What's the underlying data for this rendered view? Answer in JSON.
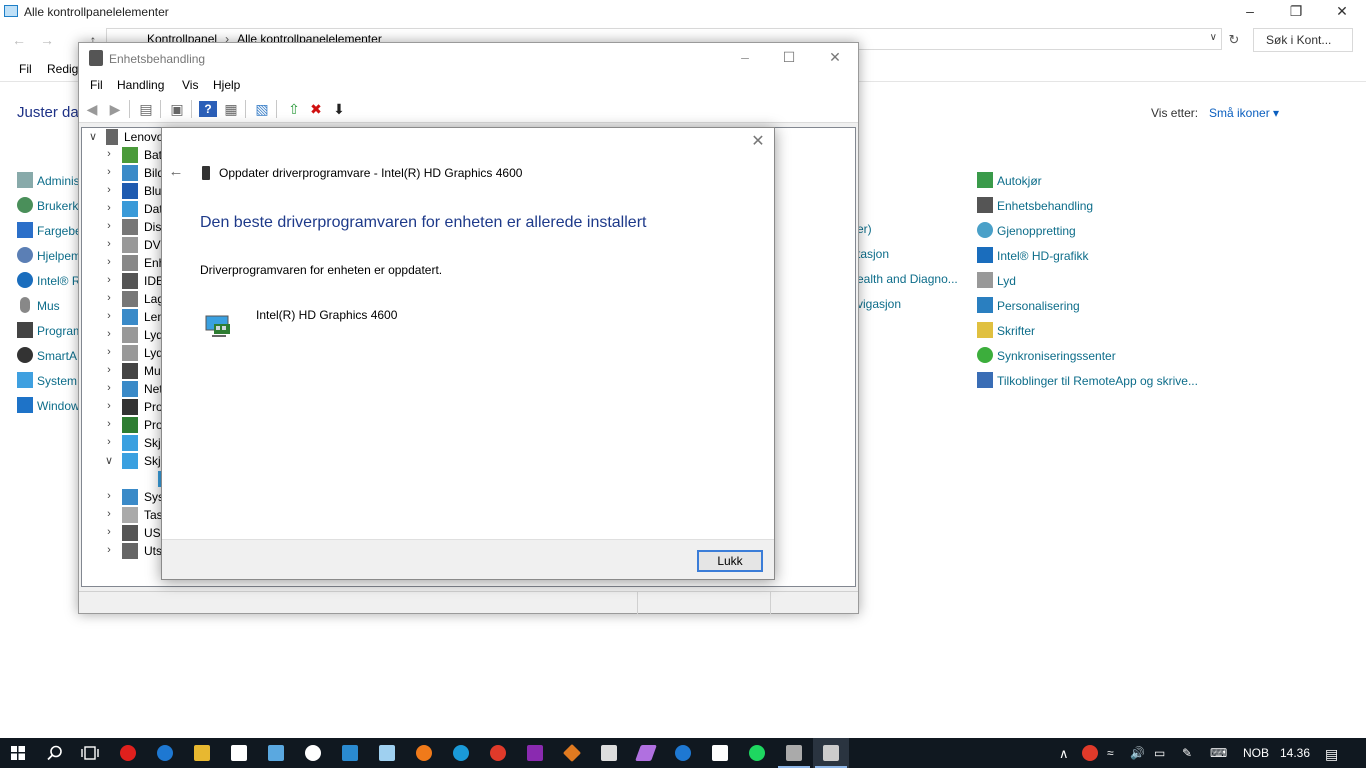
{
  "control_panel": {
    "title": "Alle kontrollpanelelementer",
    "breadcrumb": [
      "Kontrollpanel",
      "Alle kontrollpanelelementer"
    ],
    "search_placeholder": "Søk i Kont...",
    "menu": [
      "Fil",
      "Redige"
    ],
    "heading": "Juster da",
    "view_by_label": "Vis etter:",
    "view_by_value": "Små ikoner",
    "left_items": [
      "Adminis",
      "Brukerk",
      "Fargebe",
      "Hjelpem",
      "Intel® R",
      "Mus",
      "Program",
      "SmartA",
      "System",
      "Window"
    ],
    "mid_items": [
      "er)",
      "tasjon",
      "ealth and Diagno...",
      "vigasjon"
    ],
    "right_items": [
      "Autokjør",
      "Enhetsbehandling",
      "Gjenoppretting",
      "Intel® HD-grafikk",
      "Lyd",
      "Personalisering",
      "Skrifter",
      "Synkroniseringssenter",
      "Tilkoblinger til RemoteApp og skrive..."
    ]
  },
  "device_manager": {
    "title": "Enhetsbehandling",
    "menu": [
      "Fil",
      "Handling",
      "Vis",
      "Hjelp"
    ],
    "root": "Lenovo",
    "tree": [
      "Batt",
      "Bild",
      "Blue",
      "Dat",
      "Disk",
      "DVD",
      "Enh",
      "IDE",
      "Lag",
      "Len",
      "Lyd",
      "Lyd",
      "Mu",
      "Net",
      "Pro",
      "Pro",
      "Skje",
      "Skje",
      "",
      "Syst",
      "Tast",
      "USB",
      "Utsk"
    ]
  },
  "dialog": {
    "header": "Oppdater driverprogramvare - Intel(R) HD Graphics 4600",
    "heading": "Den beste driverprogramvaren for enheten er allerede installert",
    "message": "Driverprogramvaren for enheten er oppdatert.",
    "device_name": "Intel(R) HD Graphics 4600",
    "close_button": "Lukk"
  },
  "taskbar": {
    "language": "NOB",
    "clock": "14.36"
  },
  "colors": {
    "accent": "#1e3a8a",
    "link": "#0d6d8a",
    "taskbar": "#101820"
  }
}
